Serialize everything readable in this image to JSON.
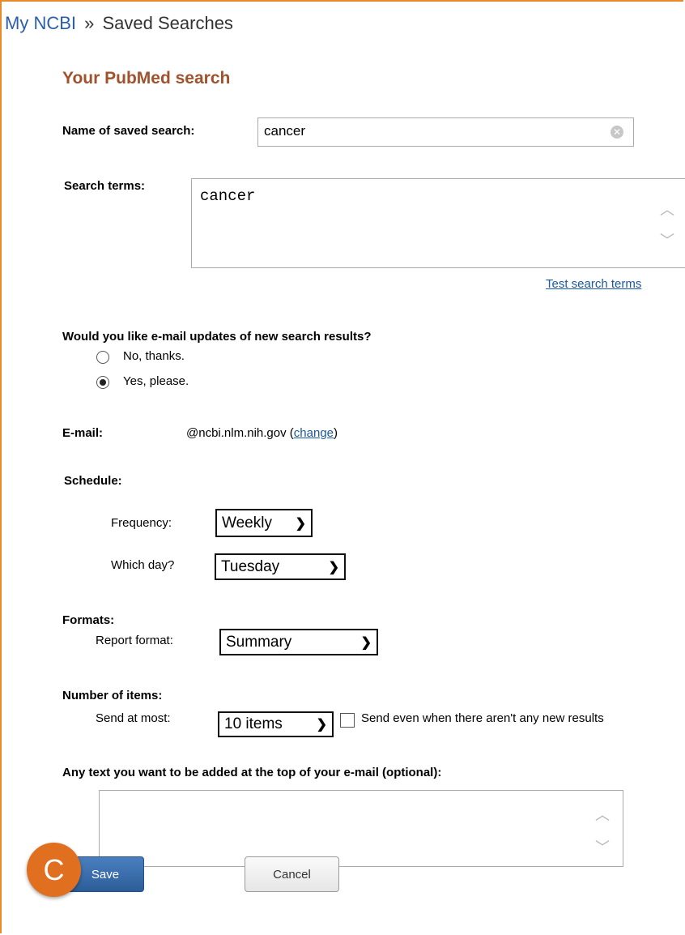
{
  "breadcrumb": {
    "root": "My NCBI",
    "separator": "»",
    "current": "Saved Searches"
  },
  "page_title": "Your PubMed search",
  "name_field": {
    "label": "Name of saved search:",
    "value": "cancer"
  },
  "search_terms": {
    "label": "Search terms:",
    "value": "cancer",
    "test_link": "Test search terms"
  },
  "email_updates": {
    "question": "Would you like e-mail updates of new search results?",
    "options": [
      {
        "label": "No, thanks.",
        "selected": false
      },
      {
        "label": "Yes, please.",
        "selected": true
      }
    ]
  },
  "email": {
    "label": "E-mail:",
    "address": "@ncbi.nlm.nih.gov",
    "open_paren": "(",
    "change_link": "change",
    "close_paren": ")"
  },
  "schedule": {
    "label": "Schedule:",
    "frequency_label": "Frequency:",
    "frequency_value": "Weekly",
    "day_label": "Which day?",
    "day_value": "Tuesday"
  },
  "formats": {
    "label": "Formats:",
    "report_label": "Report format:",
    "report_value": "Summary"
  },
  "items": {
    "label": "Number of items:",
    "send_label": "Send at most:",
    "send_value": "10 items",
    "send_even_label": "Send even when there aren't any new results",
    "send_even_checked": false
  },
  "message": {
    "label": "Any text you want to be added at the top of your e-mail (optional):",
    "value": ""
  },
  "badge": {
    "letter": "C",
    "color": "#e07020"
  },
  "buttons": {
    "save": "Save",
    "cancel": "Cancel"
  },
  "colors": {
    "title": "#a0522d",
    "link": "#1a5aa0",
    "save_button": "#2c5d98",
    "frame": "#e88a2a"
  },
  "icons": {
    "clear": "clear-circle-icon",
    "scroll_up": "chevron-up-icon",
    "scroll_down": "chevron-down-icon",
    "select": "chevron-down-icon"
  }
}
